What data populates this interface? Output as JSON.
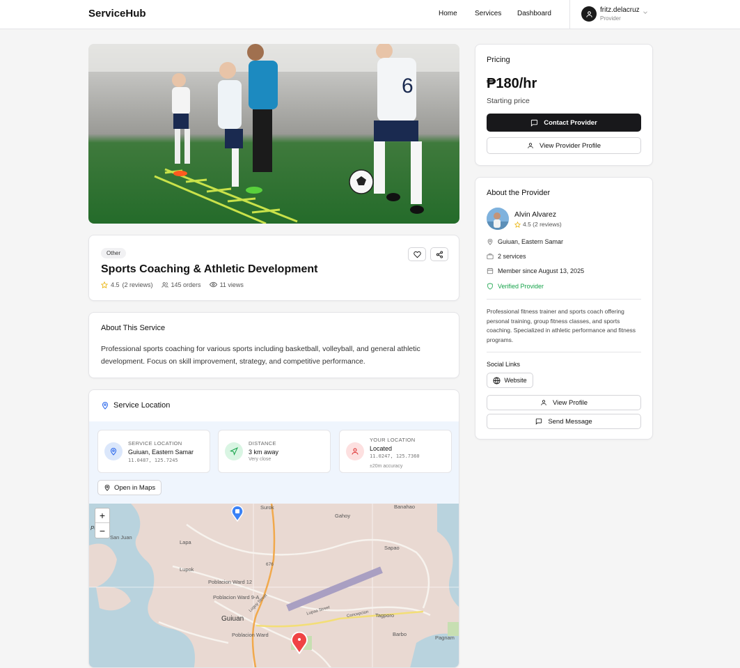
{
  "header": {
    "brand": "ServiceHub",
    "nav": [
      "Home",
      "Services",
      "Dashboard"
    ],
    "user_name": "fritz.delacruz",
    "user_role": "Provider"
  },
  "service": {
    "category": "Other",
    "title": "Sports Coaching & Athletic Development",
    "rating": "4.5",
    "reviews": "(2 reviews)",
    "orders": "145 orders",
    "views": "11 views"
  },
  "about": {
    "heading": "About This Service",
    "text": "Professional sports coaching for various sports including basketball, volleyball, and general athletic development. Focus on skill improvement, strategy, and competitive performance."
  },
  "location": {
    "heading": "Service Location",
    "service_label": "SERVICE LOCATION",
    "service_value": "Guiuan, Eastern Samar",
    "service_coords": "11.0487, 125.7245",
    "distance_label": "DISTANCE",
    "distance_value": "3 km away",
    "distance_sub": "Very close",
    "your_label": "YOUR LOCATION",
    "your_value": "Located",
    "your_coords": "11.0247, 125.7360",
    "your_accuracy": "±20m accuracy",
    "open_maps": "Open in Maps",
    "zoom_in": "+",
    "zoom_out": "−",
    "map_labels": [
      "Surok",
      "Banahao",
      "Gahoy",
      "San Juan",
      "Lapa",
      "Sapao",
      "Lupok",
      "Poblacion Ward 12",
      "Poblacion Ward 9-A",
      "Guiuan",
      "Poblacion Ward",
      "Tagporo",
      "Barbo",
      "Pagnam",
      "676",
      "Luguy Street",
      "Lupaa Street",
      "Concepcion",
      "Poo"
    ]
  },
  "pricing": {
    "label": "Pricing",
    "price": "₱180/hr",
    "sub": "Starting price",
    "contact": "Contact Provider",
    "view_profile": "View Provider Profile"
  },
  "provider": {
    "heading": "About the Provider",
    "name": "Alvin Alvarez",
    "rating": "4.5 (2 reviews)",
    "location": "Guiuan, Eastern Samar",
    "services": "2 services",
    "member": "Member since August 13, 2025",
    "verified": "Verified Provider",
    "bio": "Professional fitness trainer and sports coach offering personal training, group fitness classes, and sports coaching. Specialized in athletic performance and fitness programs.",
    "social_label": "Social Links",
    "website": "Website",
    "view_profile": "View Profile",
    "send_message": "Send Message"
  },
  "colors": {
    "primary": "#18181b",
    "star": "#eab308",
    "verified": "#16a34a",
    "location_blue": "#2563eb",
    "pin_red": "#dc2626"
  }
}
